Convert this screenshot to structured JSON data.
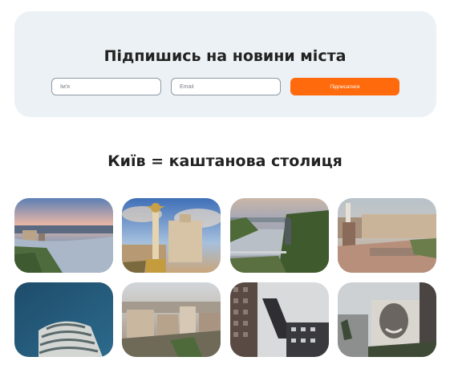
{
  "subscribe": {
    "title": "Підпишись на новини міста",
    "name_placeholder": "Ім'я",
    "email_placeholder": "Email",
    "button_label": "Підписатися",
    "accent_color": "#ff6a0d",
    "card_color": "#ebf1f4"
  },
  "gallery": {
    "title": "Київ = каштанова столиця",
    "photos": [
      {
        "subject": "river-city-sunset"
      },
      {
        "subject": "independence-monument"
      },
      {
        "subject": "dnipro-river-bridge"
      },
      {
        "subject": "maidan-square"
      },
      {
        "subject": "round-tower-building"
      },
      {
        "subject": "city-rooftops"
      },
      {
        "subject": "modern-highrise"
      },
      {
        "subject": "mural-building"
      }
    ]
  }
}
